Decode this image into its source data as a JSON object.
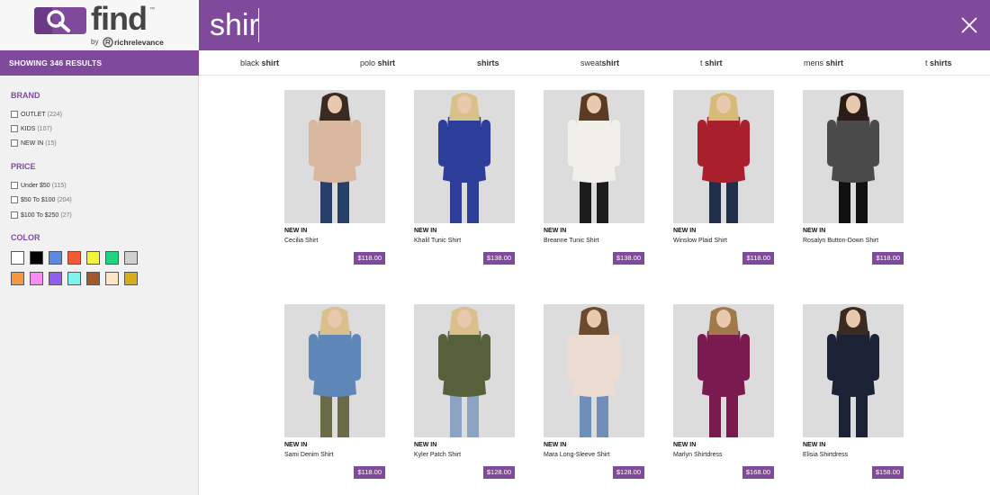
{
  "colors": {
    "brand": "#7f4a9c",
    "sidebar_bg": "#f1f1f1"
  },
  "logo": {
    "word": "find",
    "tm": "™",
    "by": "by",
    "company": "richrelevance"
  },
  "search": {
    "value": "shir"
  },
  "results": {
    "label": "SHOWING 346 RESULTS"
  },
  "suggestions": [
    {
      "pre": "black ",
      "bold": "shirt"
    },
    {
      "pre": "polo ",
      "bold": "shirt"
    },
    {
      "pre": "",
      "bold": "shirts"
    },
    {
      "pre": "sweat",
      "bold": "shirt"
    },
    {
      "pre": "t ",
      "bold": "shirt"
    },
    {
      "pre": "mens ",
      "bold": "shirt"
    },
    {
      "pre": "t ",
      "bold": "shirts"
    }
  ],
  "facets": {
    "brand": {
      "title": "BRAND",
      "items": [
        {
          "label": "OUTLET",
          "count": "(224)"
        },
        {
          "label": "KIDS",
          "count": "(107)"
        },
        {
          "label": "NEW IN",
          "count": "(15)"
        }
      ]
    },
    "price": {
      "title": "PRICE",
      "items": [
        {
          "label": "Under $50",
          "count": "(115)"
        },
        {
          "label": "$50 To $100",
          "count": "(204)"
        },
        {
          "label": "$100 To $250",
          "count": "(27)"
        }
      ]
    },
    "color": {
      "title": "COLOR",
      "swatches": [
        {
          "name": "white",
          "hex": "#ffffff"
        },
        {
          "name": "black",
          "hex": "#000000"
        },
        {
          "name": "blue",
          "hex": "#5b8be0"
        },
        {
          "name": "red",
          "hex": "#f25a33"
        },
        {
          "name": "yellow",
          "hex": "#f4f33a"
        },
        {
          "name": "green",
          "hex": "#22d47f"
        },
        {
          "name": "grey",
          "hex": "#d0d0d0"
        },
        {
          "name": "orange",
          "hex": "#f5973e"
        },
        {
          "name": "pink",
          "hex": "#f58ef0"
        },
        {
          "name": "purple",
          "hex": "#8f5ef0"
        },
        {
          "name": "aqua",
          "hex": "#7ff3ef"
        },
        {
          "name": "brown",
          "hex": "#a05a2c"
        },
        {
          "name": "cream",
          "hex": "#fce5c8"
        },
        {
          "name": "gold",
          "hex": "#d6ae1c"
        }
      ]
    }
  },
  "products": [
    {
      "tag": "NEW IN",
      "name": "Cecilia Shirt",
      "price": "$118.00",
      "top_color": "#d9b79e",
      "bottom_color": "#27406a",
      "hair_color": "#3a2a22"
    },
    {
      "tag": "NEW IN",
      "name": "Khalil Tunic Shirt",
      "price": "$138.00",
      "top_color": "#2d3d9a",
      "bottom_color": "#2d3d9a",
      "hair_color": "#d9c28a"
    },
    {
      "tag": "NEW IN",
      "name": "Breanne Tunic Shirt",
      "price": "$138.00",
      "top_color": "#f2f0ea",
      "bottom_color": "#1b1b1b",
      "hair_color": "#5a3b26"
    },
    {
      "tag": "NEW IN",
      "name": "Winslow Plaid Shirt",
      "price": "$118.00",
      "top_color": "#a8202b",
      "bottom_color": "#1f2f4a",
      "hair_color": "#d7b978"
    },
    {
      "tag": "NEW IN",
      "name": "Rosalyn Button-Down Shirt",
      "price": "$118.00",
      "top_color": "#4a4a4a",
      "bottom_color": "#111111",
      "hair_color": "#2a1d17"
    },
    {
      "tag": "NEW IN",
      "name": "Sami Denim Shirt",
      "price": "$118.00",
      "top_color": "#5e86b8",
      "bottom_color": "#6b6b4a",
      "hair_color": "#d9c08c"
    },
    {
      "tag": "NEW IN",
      "name": "Kyler Patch Shirt",
      "price": "$128.00",
      "top_color": "#56603a",
      "bottom_color": "#8aa3c2",
      "hair_color": "#d9c08c"
    },
    {
      "tag": "NEW IN",
      "name": "Mara Long-Sleeve Shirt",
      "price": "$128.00",
      "top_color": "#ecdcd2",
      "bottom_color": "#6f8fb8",
      "hair_color": "#6b4a2e"
    },
    {
      "tag": "NEW IN",
      "name": "Marlyn Shirtdress",
      "price": "$168.00",
      "top_color": "#7b1a4e",
      "bottom_color": "#7b1a4e",
      "hair_color": "#a07a4a"
    },
    {
      "tag": "NEW IN",
      "name": "Elisia Shirtdress",
      "price": "$158.00",
      "top_color": "#1b2236",
      "bottom_color": "#1b2236",
      "hair_color": "#3b2a20"
    }
  ]
}
